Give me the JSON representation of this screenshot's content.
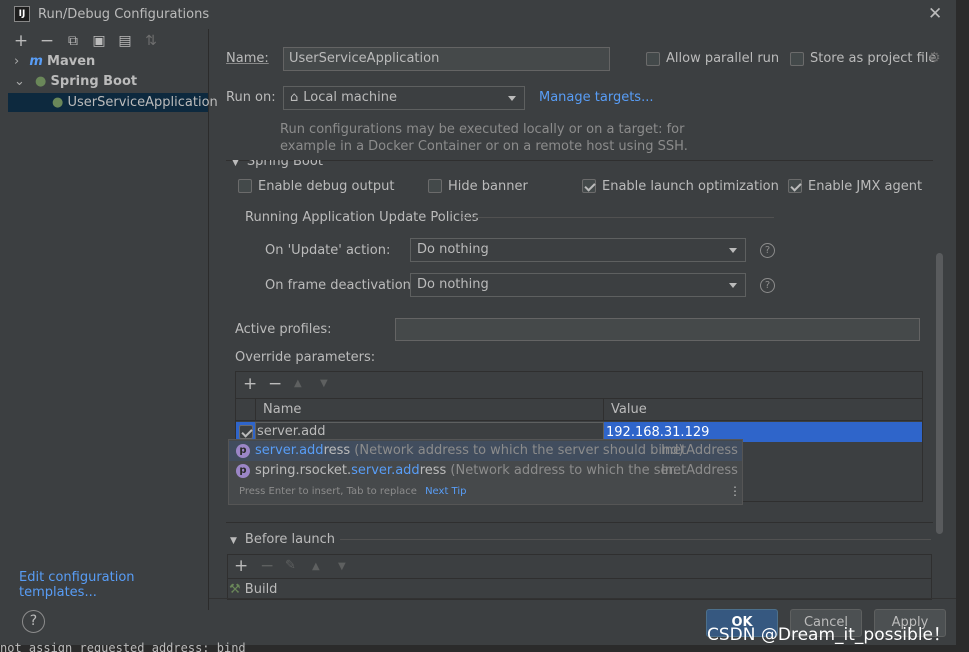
{
  "window": {
    "title": "Run/Debug Configurations",
    "app_icon": "IJ"
  },
  "toolbar_icons": [
    "add-icon",
    "remove-icon",
    "copy-icon",
    "save-icon",
    "folder-add-icon",
    "sort-icon"
  ],
  "tree": {
    "maven": "Maven",
    "spring_boot": "Spring Boot",
    "user_service": "UserServiceApplication"
  },
  "edit_templates": "Edit configuration templates...",
  "name_label": "Name:",
  "name_value": "UserServiceApplication",
  "allow_parallel": "Allow parallel run",
  "store_project": "Store as project file",
  "run_on_label": "Run on:",
  "run_on_value": "Local machine",
  "manage_targets": "Manage targets...",
  "run_on_hint_1": "Run configurations may be executed locally or on a target: for",
  "run_on_hint_2": "example in a Docker Container or on a remote host using SSH.",
  "spring_boot_section": "Spring Boot",
  "enable_debug": "Enable debug output",
  "hide_banner": "Hide banner",
  "enable_launch_opt": "Enable launch optimization",
  "enable_jmx": "Enable JMX agent",
  "policies_title": "Running Application Update Policies",
  "on_update_label": "On 'Update' action:",
  "on_update_value": "Do nothing",
  "on_frame_label": "On frame deactivation:",
  "on_frame_value": "Do nothing",
  "active_profiles": "Active profiles:",
  "override_params": "Override parameters:",
  "table": {
    "col_name": "Name",
    "col_value": "Value",
    "row_name": "server.add",
    "row_value": "192.168.31.129"
  },
  "completion": {
    "item1_pre": "server.add",
    "item1_post": "ress",
    "item1_desc": " (Network address to which the server should bind)",
    "item1_type": "InetAddress",
    "item2_a": "spring.rsocket.",
    "item2_b": "server.add",
    "item2_c": "ress",
    "item2_desc": " (Network address to which the ser...",
    "item2_type": "InetAddress",
    "footer": "Press Enter to insert, Tab to replace",
    "next_tip": "Next Tip"
  },
  "before_launch": "Before launch",
  "build": "Build",
  "buttons": {
    "ok": "OK",
    "cancel": "Cancel",
    "apply": "Apply"
  },
  "background_text": "not assign requested address: bind",
  "watermark": "CSDN @Dream_it_possible！"
}
